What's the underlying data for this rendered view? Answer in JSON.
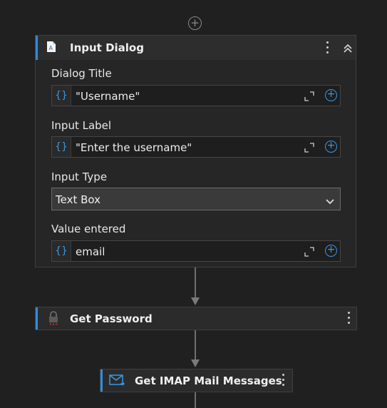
{
  "input_dialog": {
    "title": "Input Dialog",
    "fields": [
      {
        "label": "Dialog Title",
        "value": "\"Username\""
      },
      {
        "label": "Input Label",
        "value": "\"Enter the username\""
      },
      {
        "label": "Value entered",
        "value": "email"
      }
    ],
    "input_type": {
      "label": "Input Type",
      "selected": "Text Box"
    }
  },
  "get_password": {
    "title": "Get Password"
  },
  "get_imap": {
    "title": "Get IMAP Mail Messages"
  },
  "icons": {
    "add_activity": "plus-circle",
    "collapse": "double-chevron-up",
    "menu": "vertical-ellipsis",
    "variable": "curly-braces",
    "expand": "expand-corners",
    "add_field": "plus-circle-blue",
    "dropdown": "chevron-down",
    "lock": "lock",
    "mail": "envelope"
  },
  "colors": {
    "accent": "#2f8ddb",
    "background": "#202020",
    "card": "#262626"
  }
}
